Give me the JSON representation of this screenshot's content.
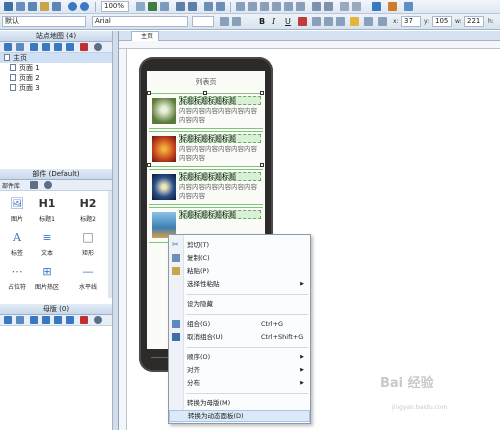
{
  "toolbar": {
    "zoom": "100%",
    "font_name": "Arial",
    "style_name": "默认",
    "x_label": "x:",
    "x_value": "37",
    "y_label": "y:",
    "y_value": "105",
    "w_label": "w:",
    "w_value": "221",
    "h_label": "h:",
    "bold": "B",
    "italic": "I",
    "underline": "U"
  },
  "sitemap": {
    "title": "站点地图 (4)",
    "root": "主页",
    "pages": [
      "页面 1",
      "页面 2",
      "页面 3"
    ]
  },
  "widgets": {
    "title": "部件 (Default)",
    "library": "部件库",
    "items": [
      {
        "glyph": "🖼",
        "label": "图片"
      },
      {
        "glyph": "H1",
        "label": "标题1"
      },
      {
        "glyph": "H2",
        "label": "标题2"
      },
      {
        "glyph": "A",
        "label": "标签"
      },
      {
        "glyph": "≡",
        "label": "文本"
      },
      {
        "glyph": "□",
        "label": "矩形"
      },
      {
        "glyph": "⋯",
        "label": "占位符"
      },
      {
        "glyph": "⊞",
        "label": "图片热区"
      },
      {
        "glyph": "—",
        "label": "水平线"
      }
    ]
  },
  "masters": {
    "title": "母版 (0)"
  },
  "canvas": {
    "tab": "主页",
    "screen_title": "列表页",
    "list_items": [
      {
        "title": "标题标题标题标题",
        "body": "内容内容内容内容内容内容内容内容",
        "color": "#5a7a3a"
      },
      {
        "title": "标题标题标题标题",
        "body": "内容内容内容内容内容内容内容内容",
        "color": "#c4431e"
      },
      {
        "title": "标题标题标题标题",
        "body": "内容内容内容内容内容内容内容内容",
        "color": "#2a4f8a"
      },
      {
        "title": "标题标题标题标题",
        "body": "",
        "color": "#3d7fb4"
      }
    ]
  },
  "context_menu": {
    "items": [
      {
        "label": "剪切(T)",
        "shortcut": "",
        "submenu": false,
        "icon": "scissors-icon"
      },
      {
        "label": "复制(C)",
        "shortcut": "",
        "submenu": false,
        "icon": "copy-icon"
      },
      {
        "label": "粘贴(P)",
        "shortcut": "",
        "submenu": false,
        "icon": "paste-icon"
      },
      {
        "label": "选择性粘贴",
        "shortcut": "",
        "submenu": true,
        "icon": ""
      },
      {
        "label": "设为隐藏",
        "shortcut": "",
        "submenu": false,
        "icon": ""
      },
      {
        "label": "组合(G)",
        "shortcut": "Ctrl+G",
        "submenu": false,
        "icon": "group-icon"
      },
      {
        "label": "取消组合(U)",
        "shortcut": "Ctrl+Shift+G",
        "submenu": false,
        "icon": "ungroup-icon"
      },
      {
        "label": "顺序(O)",
        "shortcut": "",
        "submenu": true,
        "icon": ""
      },
      {
        "label": "对齐",
        "shortcut": "",
        "submenu": true,
        "icon": ""
      },
      {
        "label": "分布",
        "shortcut": "",
        "submenu": true,
        "icon": ""
      },
      {
        "label": "转换为母版(M)",
        "shortcut": "",
        "submenu": false,
        "icon": ""
      },
      {
        "label": "转换为动态面板(D)",
        "shortcut": "",
        "submenu": false,
        "icon": ""
      }
    ]
  },
  "watermark": {
    "text": "Bai 经验",
    "url": "jingyan.baidu.com"
  },
  "colors": {
    "accent": "#3a78c2",
    "selection_green": "#7ec47a",
    "menu_highlight": "#dce9f8"
  }
}
